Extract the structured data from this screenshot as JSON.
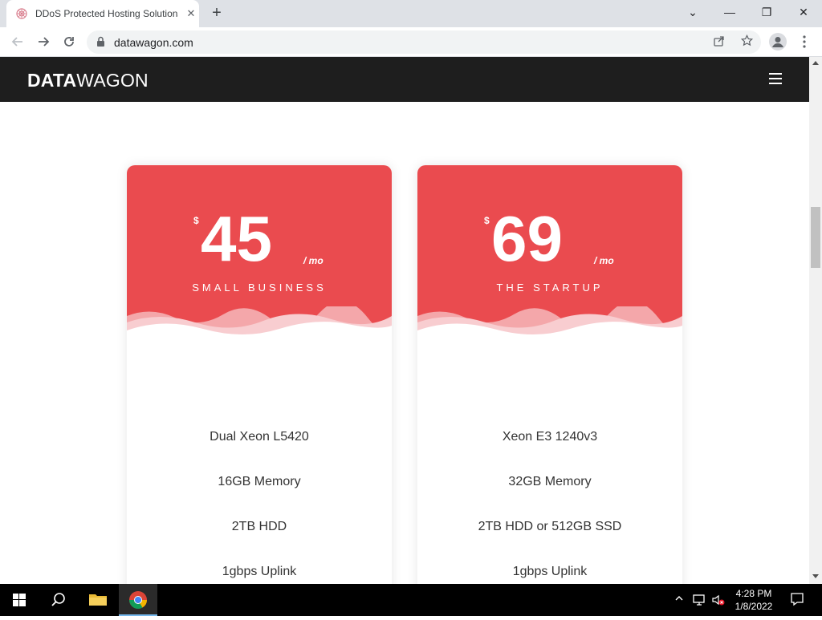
{
  "browser": {
    "tab_title": "DDoS Protected Hosting Solutions",
    "tab_close": "✕",
    "new_tab": "+",
    "url": "datawagon.com",
    "window_controls": [
      "⌄",
      "—",
      "❐",
      "✕"
    ]
  },
  "site": {
    "brand_bold": "DATA",
    "brand_light": "WAGON"
  },
  "plans": [
    {
      "currency": "$",
      "price": "45",
      "period": "/ mo",
      "name": "SMALL BUSINESS",
      "features": [
        "Dual Xeon L5420",
        "16GB Memory",
        "2TB HDD",
        "1gbps Uplink"
      ]
    },
    {
      "currency": "$",
      "price": "69",
      "period": "/ mo",
      "name": "THE STARTUP",
      "features": [
        "Xeon E3 1240v3",
        "32GB Memory",
        "2TB HDD or 512GB SSD",
        "1gbps Uplink"
      ]
    }
  ],
  "colors": {
    "accent": "#ea4b4f",
    "nav_bg": "#1e1e1e"
  },
  "taskbar": {
    "time": "4:28 PM",
    "date": "1/8/2022"
  }
}
